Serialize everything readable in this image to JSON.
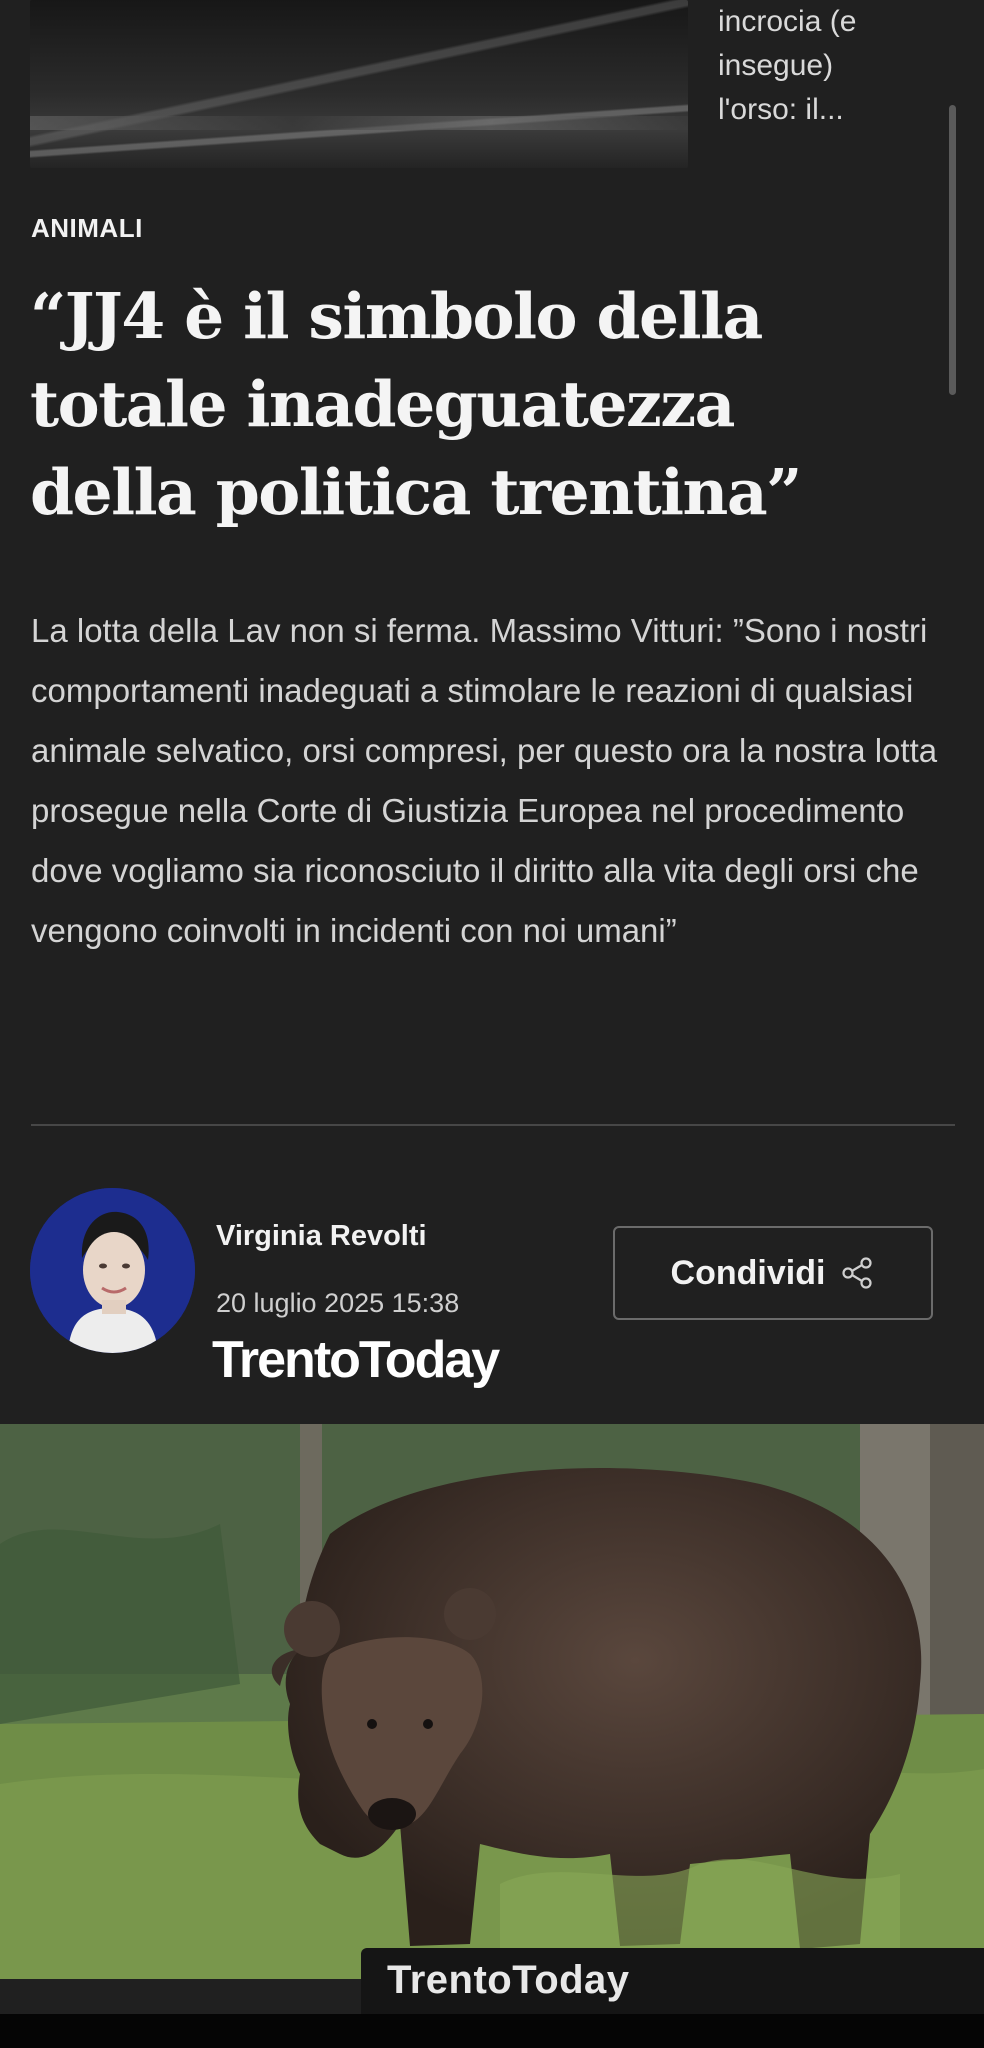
{
  "related": {
    "snippet_lines": [
      "incrocia (e",
      "insegue)",
      "l'orso: il..."
    ]
  },
  "article": {
    "category": "ANIMALI",
    "headline_lines": [
      "“JJ4 è il simbolo della",
      "totale inadeguatezza",
      "della politica trentina”"
    ],
    "summary": "La lotta della Lav non si ferma. Massimo Vitturi: ”Sono i nostri comportamenti inadeguati a stimolare le reazioni di qualsiasi animale selvatico, orsi compresi, per questo ora la nostra lotta prosegue nella Corte di Giustizia Europea nel procedimento dove vogliamo sia riconosciuto il diritto alla vita degli orsi che vengono coinvolti in incidenti con noi umani”",
    "author": "Virginia Revolti",
    "date": "20 luglio 2025 15:38",
    "share_label": "Condividi",
    "share_icon": "share-icon"
  },
  "watermarks": {
    "overlay": "TrentoToday",
    "photo": "TrentoToday"
  },
  "colors": {
    "background": "#202020",
    "avatar_bg": "#1d2d8f"
  }
}
